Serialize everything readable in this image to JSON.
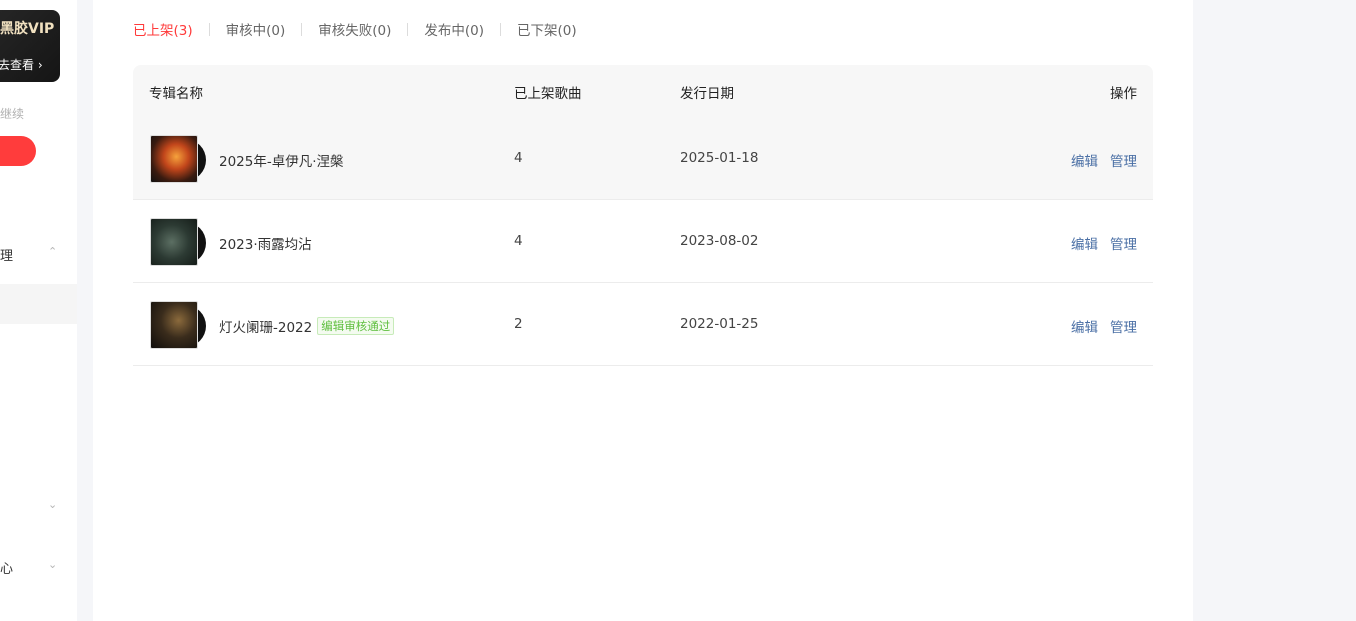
{
  "sidebar": {
    "vip_title": "黑胶VIP",
    "vip_cta": "去查看 ›",
    "hint": "继续",
    "red_button": "",
    "groups": [
      {
        "label": "理",
        "chevron": "⌃"
      },
      {
        "label": "",
        "chevron": "⌄"
      },
      {
        "label": "心",
        "chevron": "⌄"
      }
    ]
  },
  "tabs": [
    {
      "label": "已上架(3)",
      "active": true
    },
    {
      "label": "审核中(0)",
      "active": false
    },
    {
      "label": "审核失败(0)",
      "active": false
    },
    {
      "label": "发布中(0)",
      "active": false
    },
    {
      "label": "已下架(0)",
      "active": false
    }
  ],
  "table": {
    "headers": {
      "name": "专辑名称",
      "songs": "已上架歌曲",
      "date": "发行日期",
      "ops": "操作"
    },
    "rows": [
      {
        "name": "2025年-卓伊凡·涅槃",
        "badge": "",
        "songs": "4",
        "date": "2025-01-18",
        "edit": "编辑",
        "manage": "管理"
      },
      {
        "name": "2023·雨露均沾",
        "badge": "",
        "songs": "4",
        "date": "2023-08-02",
        "edit": "编辑",
        "manage": "管理"
      },
      {
        "name": "灯火阑珊-2022",
        "badge": "编辑审核通过",
        "songs": "2",
        "date": "2022-01-25",
        "edit": "编辑",
        "manage": "管理"
      }
    ]
  },
  "colors": {
    "accent": "#ff3a3a",
    "link": "#4a6fa5",
    "badge": "#5fbf3f"
  }
}
